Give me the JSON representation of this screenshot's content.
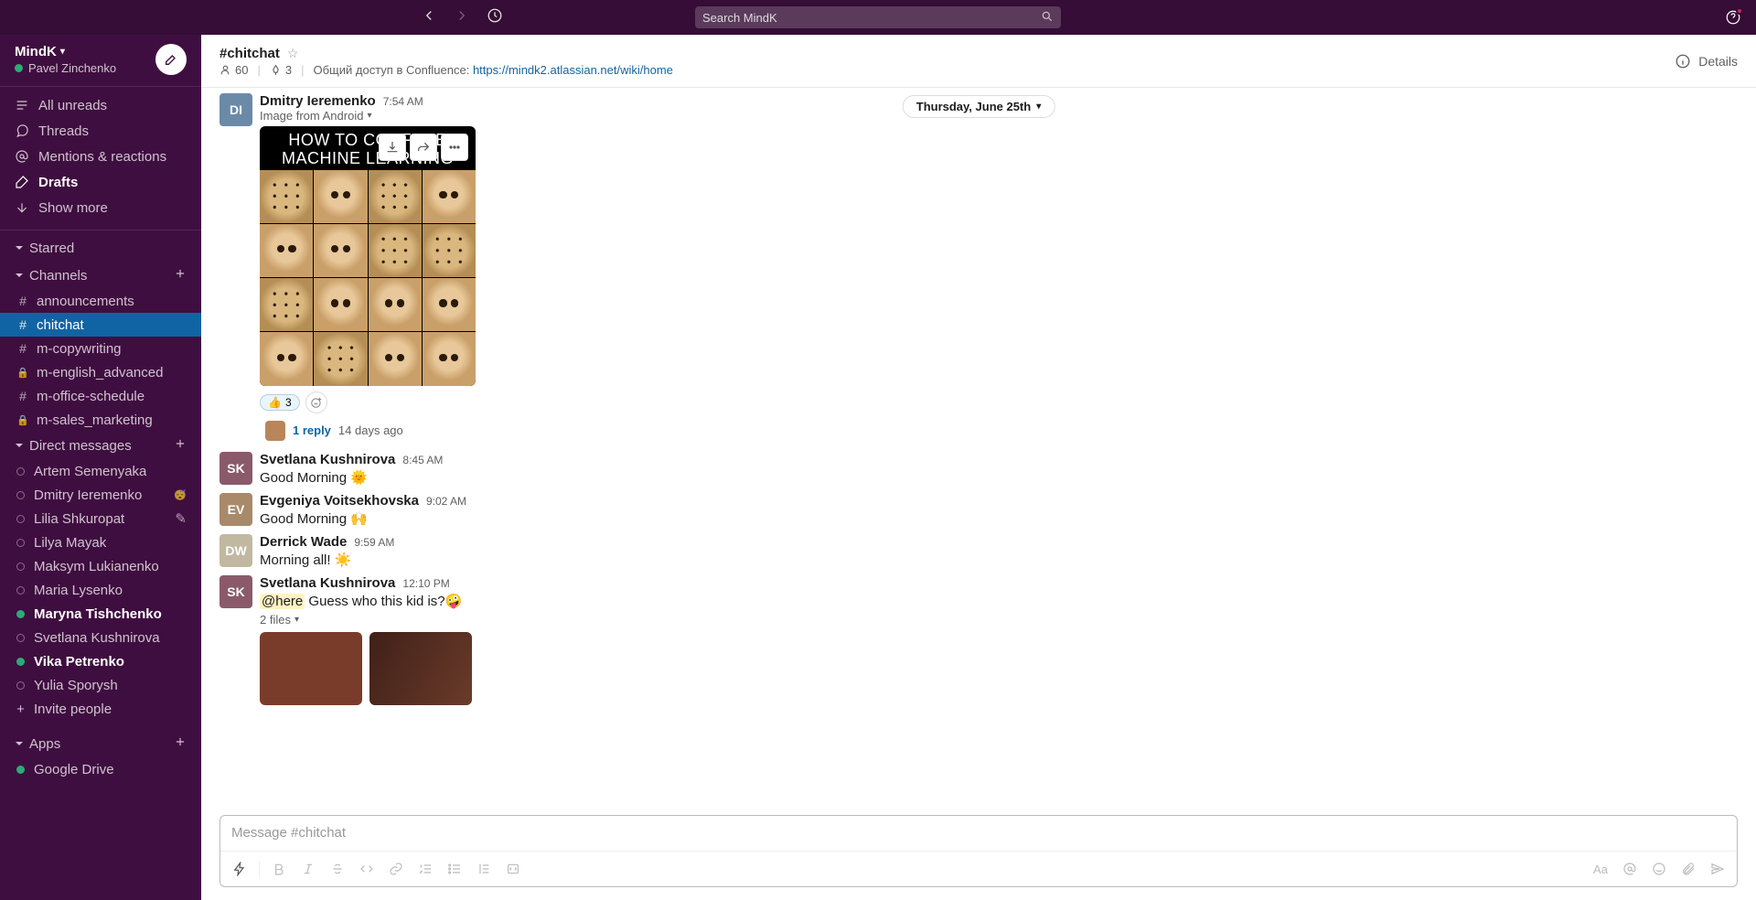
{
  "topbar": {
    "search_placeholder": "Search MindK"
  },
  "workspace": {
    "name": "MindK",
    "user": "Pavel Zinchenko"
  },
  "nav": {
    "all_unreads": "All unreads",
    "threads": "Threads",
    "mentions": "Mentions & reactions",
    "drafts": "Drafts",
    "show_more": "Show more"
  },
  "sections": {
    "starred": "Starred",
    "channels": "Channels",
    "dms": "Direct messages",
    "apps": "Apps"
  },
  "channels": [
    {
      "name": "announcements",
      "private": false
    },
    {
      "name": "chitchat",
      "private": false,
      "active": true
    },
    {
      "name": "m-copywriting",
      "private": false
    },
    {
      "name": "m-english_advanced",
      "private": true
    },
    {
      "name": "m-office-schedule",
      "private": false
    },
    {
      "name": "m-sales_marketing",
      "private": true
    }
  ],
  "dms": [
    {
      "name": "Artem Semenyaka",
      "online": false
    },
    {
      "name": "Dmitry Ieremenko",
      "online": false,
      "sleep": true
    },
    {
      "name": "Lilia Shkuropat",
      "online": false,
      "edit": true
    },
    {
      "name": "Lilya Mayak",
      "online": false
    },
    {
      "name": "Maksym Lukianenko",
      "online": false
    },
    {
      "name": "Maria Lysenko",
      "online": false
    },
    {
      "name": "Maryna Tishchenko",
      "online": true,
      "self": true
    },
    {
      "name": "Svetlana Kushnirova",
      "online": false
    },
    {
      "name": "Vika Petrenko",
      "online": true,
      "self": true
    },
    {
      "name": "Yulia Sporysh",
      "online": false
    }
  ],
  "invite": "Invite people",
  "apps": [
    {
      "name": "Google Drive",
      "online": true
    }
  ],
  "header": {
    "title": "#chitchat",
    "members": "60",
    "pins": "3",
    "topic_prefix": "Общий доступ в Confluence: ",
    "topic_link": "https://mindk2.atlassian.net/wiki/home",
    "details": "Details"
  },
  "date_divider": "Thursday, June 25th",
  "messages": {
    "m1": {
      "author": "Dmitry Ieremenko",
      "time": "7:54 AM",
      "sub": "Image from Android",
      "meme_line1": "HOW TO CONFUSE",
      "meme_line2": "MACHINE LEARNING",
      "reaction_emoji": "👍",
      "reaction_count": "3",
      "reply_text": "1 reply",
      "reply_time": "14 days ago"
    },
    "m2": {
      "author": "Svetlana Kushnirova",
      "time": "8:45 AM",
      "text": "Good Morning 🌞"
    },
    "m3": {
      "author": "Evgeniya Voitsekhovska",
      "time": "9:02 AM",
      "text": "Good Morning 🙌"
    },
    "m4": {
      "author": "Derrick Wade",
      "time": "9:59 AM",
      "text": "Morning all! ☀️"
    },
    "m5": {
      "author": "Svetlana Kushnirova",
      "time": "12:10 PM",
      "mention": "@here",
      "text": " Guess who this kid is?🤪",
      "files": "2 files"
    }
  },
  "composer": {
    "placeholder": "Message #chitchat"
  }
}
